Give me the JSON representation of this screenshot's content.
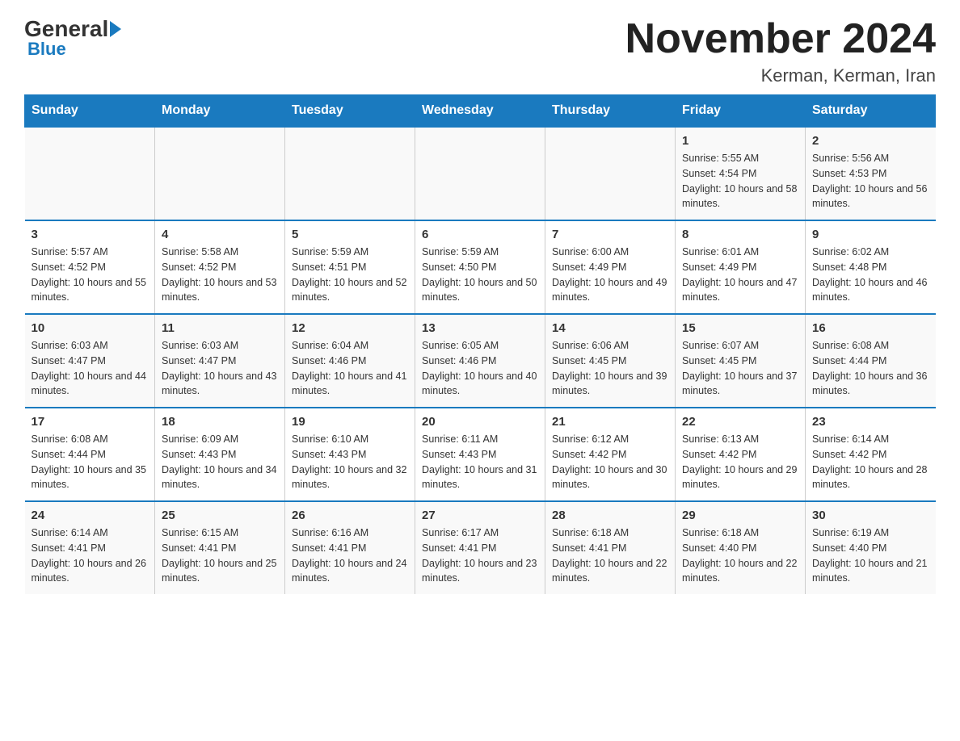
{
  "header": {
    "logo_text_general": "General",
    "logo_text_blue": "Blue",
    "month_title": "November 2024",
    "location": "Kerman, Kerman, Iran"
  },
  "weekdays": [
    "Sunday",
    "Monday",
    "Tuesday",
    "Wednesday",
    "Thursday",
    "Friday",
    "Saturday"
  ],
  "weeks": [
    [
      {
        "day": "",
        "sunrise": "",
        "sunset": "",
        "daylight": ""
      },
      {
        "day": "",
        "sunrise": "",
        "sunset": "",
        "daylight": ""
      },
      {
        "day": "",
        "sunrise": "",
        "sunset": "",
        "daylight": ""
      },
      {
        "day": "",
        "sunrise": "",
        "sunset": "",
        "daylight": ""
      },
      {
        "day": "",
        "sunrise": "",
        "sunset": "",
        "daylight": ""
      },
      {
        "day": "1",
        "sunrise": "Sunrise: 5:55 AM",
        "sunset": "Sunset: 4:54 PM",
        "daylight": "Daylight: 10 hours and 58 minutes."
      },
      {
        "day": "2",
        "sunrise": "Sunrise: 5:56 AM",
        "sunset": "Sunset: 4:53 PM",
        "daylight": "Daylight: 10 hours and 56 minutes."
      }
    ],
    [
      {
        "day": "3",
        "sunrise": "Sunrise: 5:57 AM",
        "sunset": "Sunset: 4:52 PM",
        "daylight": "Daylight: 10 hours and 55 minutes."
      },
      {
        "day": "4",
        "sunrise": "Sunrise: 5:58 AM",
        "sunset": "Sunset: 4:52 PM",
        "daylight": "Daylight: 10 hours and 53 minutes."
      },
      {
        "day": "5",
        "sunrise": "Sunrise: 5:59 AM",
        "sunset": "Sunset: 4:51 PM",
        "daylight": "Daylight: 10 hours and 52 minutes."
      },
      {
        "day": "6",
        "sunrise": "Sunrise: 5:59 AM",
        "sunset": "Sunset: 4:50 PM",
        "daylight": "Daylight: 10 hours and 50 minutes."
      },
      {
        "day": "7",
        "sunrise": "Sunrise: 6:00 AM",
        "sunset": "Sunset: 4:49 PM",
        "daylight": "Daylight: 10 hours and 49 minutes."
      },
      {
        "day": "8",
        "sunrise": "Sunrise: 6:01 AM",
        "sunset": "Sunset: 4:49 PM",
        "daylight": "Daylight: 10 hours and 47 minutes."
      },
      {
        "day": "9",
        "sunrise": "Sunrise: 6:02 AM",
        "sunset": "Sunset: 4:48 PM",
        "daylight": "Daylight: 10 hours and 46 minutes."
      }
    ],
    [
      {
        "day": "10",
        "sunrise": "Sunrise: 6:03 AM",
        "sunset": "Sunset: 4:47 PM",
        "daylight": "Daylight: 10 hours and 44 minutes."
      },
      {
        "day": "11",
        "sunrise": "Sunrise: 6:03 AM",
        "sunset": "Sunset: 4:47 PM",
        "daylight": "Daylight: 10 hours and 43 minutes."
      },
      {
        "day": "12",
        "sunrise": "Sunrise: 6:04 AM",
        "sunset": "Sunset: 4:46 PM",
        "daylight": "Daylight: 10 hours and 41 minutes."
      },
      {
        "day": "13",
        "sunrise": "Sunrise: 6:05 AM",
        "sunset": "Sunset: 4:46 PM",
        "daylight": "Daylight: 10 hours and 40 minutes."
      },
      {
        "day": "14",
        "sunrise": "Sunrise: 6:06 AM",
        "sunset": "Sunset: 4:45 PM",
        "daylight": "Daylight: 10 hours and 39 minutes."
      },
      {
        "day": "15",
        "sunrise": "Sunrise: 6:07 AM",
        "sunset": "Sunset: 4:45 PM",
        "daylight": "Daylight: 10 hours and 37 minutes."
      },
      {
        "day": "16",
        "sunrise": "Sunrise: 6:08 AM",
        "sunset": "Sunset: 4:44 PM",
        "daylight": "Daylight: 10 hours and 36 minutes."
      }
    ],
    [
      {
        "day": "17",
        "sunrise": "Sunrise: 6:08 AM",
        "sunset": "Sunset: 4:44 PM",
        "daylight": "Daylight: 10 hours and 35 minutes."
      },
      {
        "day": "18",
        "sunrise": "Sunrise: 6:09 AM",
        "sunset": "Sunset: 4:43 PM",
        "daylight": "Daylight: 10 hours and 34 minutes."
      },
      {
        "day": "19",
        "sunrise": "Sunrise: 6:10 AM",
        "sunset": "Sunset: 4:43 PM",
        "daylight": "Daylight: 10 hours and 32 minutes."
      },
      {
        "day": "20",
        "sunrise": "Sunrise: 6:11 AM",
        "sunset": "Sunset: 4:43 PM",
        "daylight": "Daylight: 10 hours and 31 minutes."
      },
      {
        "day": "21",
        "sunrise": "Sunrise: 6:12 AM",
        "sunset": "Sunset: 4:42 PM",
        "daylight": "Daylight: 10 hours and 30 minutes."
      },
      {
        "day": "22",
        "sunrise": "Sunrise: 6:13 AM",
        "sunset": "Sunset: 4:42 PM",
        "daylight": "Daylight: 10 hours and 29 minutes."
      },
      {
        "day": "23",
        "sunrise": "Sunrise: 6:14 AM",
        "sunset": "Sunset: 4:42 PM",
        "daylight": "Daylight: 10 hours and 28 minutes."
      }
    ],
    [
      {
        "day": "24",
        "sunrise": "Sunrise: 6:14 AM",
        "sunset": "Sunset: 4:41 PM",
        "daylight": "Daylight: 10 hours and 26 minutes."
      },
      {
        "day": "25",
        "sunrise": "Sunrise: 6:15 AM",
        "sunset": "Sunset: 4:41 PM",
        "daylight": "Daylight: 10 hours and 25 minutes."
      },
      {
        "day": "26",
        "sunrise": "Sunrise: 6:16 AM",
        "sunset": "Sunset: 4:41 PM",
        "daylight": "Daylight: 10 hours and 24 minutes."
      },
      {
        "day": "27",
        "sunrise": "Sunrise: 6:17 AM",
        "sunset": "Sunset: 4:41 PM",
        "daylight": "Daylight: 10 hours and 23 minutes."
      },
      {
        "day": "28",
        "sunrise": "Sunrise: 6:18 AM",
        "sunset": "Sunset: 4:41 PM",
        "daylight": "Daylight: 10 hours and 22 minutes."
      },
      {
        "day": "29",
        "sunrise": "Sunrise: 6:18 AM",
        "sunset": "Sunset: 4:40 PM",
        "daylight": "Daylight: 10 hours and 22 minutes."
      },
      {
        "day": "30",
        "sunrise": "Sunrise: 6:19 AM",
        "sunset": "Sunset: 4:40 PM",
        "daylight": "Daylight: 10 hours and 21 minutes."
      }
    ]
  ]
}
